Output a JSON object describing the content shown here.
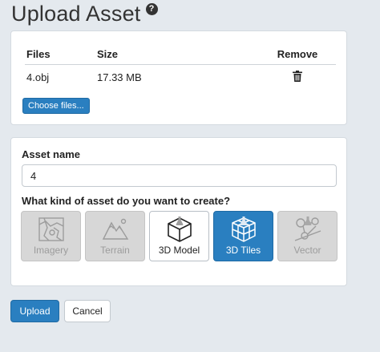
{
  "page": {
    "title": "Upload Asset",
    "help_icon": "question-circle-icon"
  },
  "files": {
    "headers": {
      "name": "Files",
      "size": "Size",
      "remove": "Remove"
    },
    "rows": [
      {
        "name": "4.obj",
        "size": "17.33 MB",
        "remove_icon": "trash-icon"
      }
    ],
    "choose_label": "Choose files..."
  },
  "asset": {
    "name_label": "Asset name",
    "name_value": "4",
    "kind_question": "What kind of asset do you want to create?",
    "kinds": [
      {
        "label": "Imagery",
        "state": "disabled",
        "icon": "imagery-map-icon"
      },
      {
        "label": "Terrain",
        "state": "disabled",
        "icon": "terrain-mountain-icon"
      },
      {
        "label": "3D Model",
        "state": "enabled",
        "icon": "cube-icon",
        "beta_icon": "flask-icon"
      },
      {
        "label": "3D Tiles",
        "state": "selected",
        "icon": "tiled-cube-icon",
        "beta_icon": "flask-icon"
      },
      {
        "label": "Vector",
        "state": "disabled",
        "icon": "vector-points-icon",
        "beta_icon": "flask-icon"
      }
    ]
  },
  "actions": {
    "upload": "Upload",
    "cancel": "Cancel"
  },
  "colors": {
    "accent": "#2a7fc0",
    "background": "#e4e9ee",
    "disabled_tile": "#d7d7d7"
  }
}
